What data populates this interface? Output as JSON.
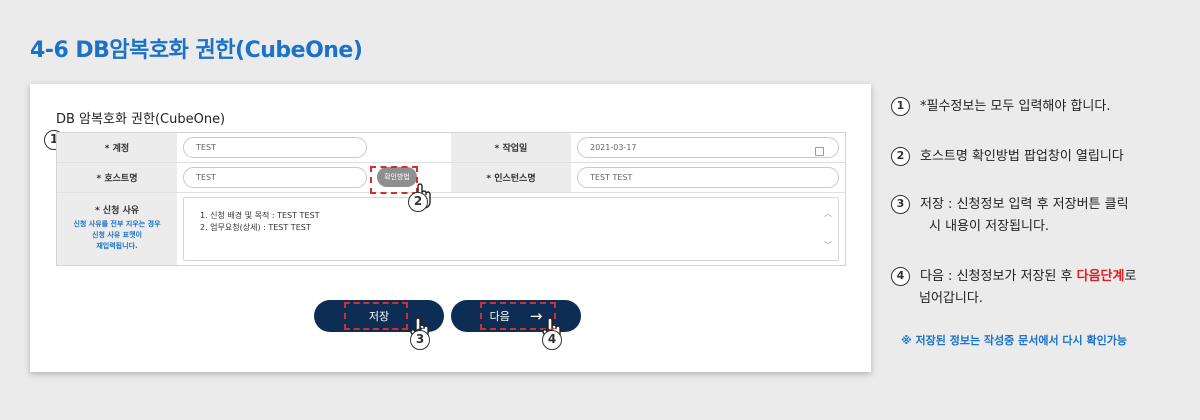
{
  "title": "4-6 DB암복호화 권한(CubeOne)",
  "card": {
    "heading": "DB 암복호화 권한(CubeOne)",
    "marker1": "1"
  },
  "form": {
    "account_label": "* 계정",
    "account_value": "TEST",
    "workday_label": "* 작업일",
    "workday_value": "2021-03-17",
    "host_label": "* 호스트명",
    "host_value": "TEST",
    "confirm_button": "확인방법",
    "instance_label": "* 인스턴스명",
    "instance_value": "TEST TEST",
    "reason_label": "* 신청 사유",
    "reason_hint_1": "신청 사유를 전부 지우는 경우",
    "reason_hint_2": "신청 사유 표맷이",
    "reason_hint_3": "재입력됩니다.",
    "reason_line_1": "1. 신청 배경 및 목적 : TEST TEST",
    "reason_line_2": "2. 업무요청(상세) : TEST TEST"
  },
  "buttons": {
    "save": "저장",
    "next": "다음",
    "next_arrow": "→"
  },
  "markers": {
    "m2": "2",
    "m3": "3",
    "m4": "4"
  },
  "steps": {
    "s1_num": "1",
    "s1_text": "*필수정보는 모두 입력해야 합니다.",
    "s2_num": "2",
    "s2_text": "호스트명 확인방법 팝업창이 열립니다",
    "s3_num": "3",
    "s3_line1": "저장 : 신청정보 입력 후 저장버튼 클릭",
    "s3_line2": "시 내용이 저장됩니다.",
    "s4_num": "4",
    "s4_pre": "다음 : 신청정보가 저장된 후 ",
    "s4_red": "다음단계",
    "s4_post": "로",
    "s4_line2": "넘어갑니다.",
    "note": "※ 저장된 정보는 작성중 문서에서 다시 확인가능"
  },
  "colors": {
    "accent": "#1a73c9",
    "navy": "#0d2d55",
    "highlight": "#d32f2f"
  },
  "icons": [
    "calendar-icon",
    "scroll-up-icon",
    "scroll-down-icon",
    "hand-cursor-icon",
    "arrow-right-icon"
  ]
}
